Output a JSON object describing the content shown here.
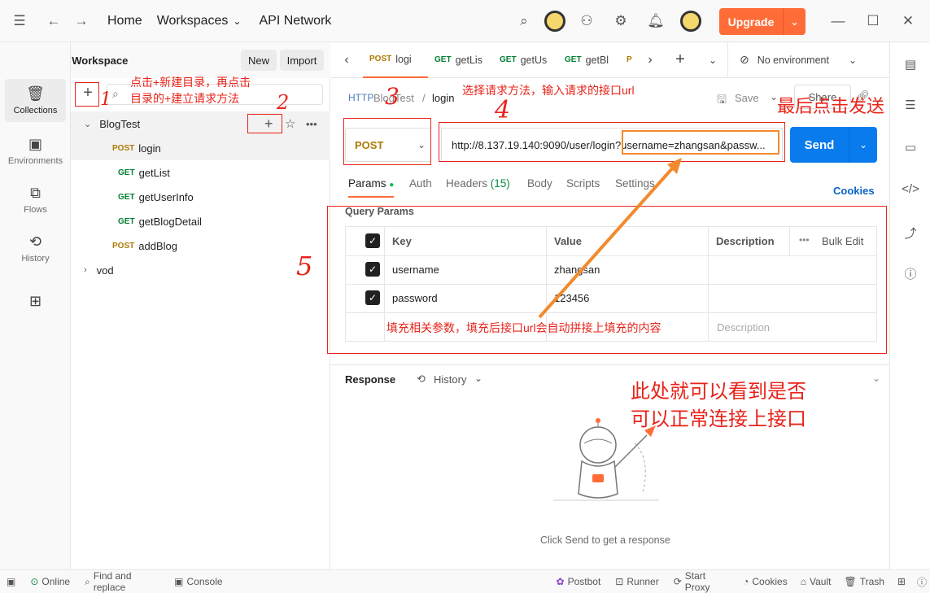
{
  "topbar": {
    "home": "Home",
    "workspaces": "Workspaces",
    "api_network": "API Network",
    "upgrade": "Upgrade"
  },
  "workspace": {
    "name": "wrrtx's Workspace",
    "new_label": "New",
    "import_label": "Import"
  },
  "rail": {
    "items": [
      {
        "label": "Collections",
        "icon": "collections-icon"
      },
      {
        "label": "Environments",
        "icon": "environments-icon"
      },
      {
        "label": "Flows",
        "icon": "flows-icon"
      },
      {
        "label": "History",
        "icon": "history-icon"
      }
    ]
  },
  "tree": {
    "collection": "BlogTest",
    "requests": [
      {
        "method": "POST",
        "name": "login"
      },
      {
        "method": "GET",
        "name": "getList"
      },
      {
        "method": "GET",
        "name": "getUserInfo"
      },
      {
        "method": "GET",
        "name": "getBlogDetail"
      },
      {
        "method": "POST",
        "name": "addBlog"
      }
    ],
    "folder2": "vod"
  },
  "tabs": [
    {
      "method": "POST",
      "name": "logi"
    },
    {
      "method": "GET",
      "name": "getLis"
    },
    {
      "method": "GET",
      "name": "getUs"
    },
    {
      "method": "GET",
      "name": "getBl"
    },
    {
      "method": "P",
      "name": ""
    }
  ],
  "environment": "No environment",
  "request": {
    "breadcrumb_collection": "BlogTest",
    "breadcrumb_sep": "/",
    "name": "login",
    "save": "Save",
    "share": "Share",
    "method": "POST",
    "url_base": "http://8.137.19.140:9090/user/login",
    "url_query": "?username=zhangsan&passw...",
    "send": "Send"
  },
  "req_tabs": {
    "params": "Params",
    "auth": "Auth",
    "headers": "Headers",
    "headers_count": "(15)",
    "body": "Body",
    "scripts": "Scripts",
    "settings": "Settings",
    "cookies": "Cookies"
  },
  "params": {
    "title": "Query Params",
    "col_key": "Key",
    "col_value": "Value",
    "col_desc": "Description",
    "bulk_edit": "Bulk Edit",
    "rows": [
      {
        "key": "username",
        "value": "zhangsan"
      },
      {
        "key": "password",
        "value": "123456"
      }
    ],
    "desc_placeholder": "Description"
  },
  "response": {
    "label": "Response",
    "history": "History",
    "hint": "Click Send to get a response"
  },
  "status_bar": {
    "online": "Online",
    "find": "Find and replace",
    "console": "Console",
    "postbot": "Postbot",
    "runner": "Runner",
    "proxy": "Start Proxy",
    "cookies": "Cookies",
    "vault": "Vault",
    "trash": "Trash"
  },
  "annotations": {
    "a1": "点击+新建目录，再点击",
    "a1b": "目录的+建立请求方法",
    "a3": "选择请求方法，输入请求的接口url",
    "a_send": "最后点击发送",
    "a5": "填充相关参数，填充后接口url会自动拼接上填充的内容",
    "a_resp1": "此处就可以看到是否",
    "a_resp2": "可以正常连接上接口",
    "n1": "1",
    "n2": "2",
    "n3": "3",
    "n4": "4",
    "n5": "5"
  },
  "colors": {
    "accent": "#ff6c37",
    "send": "#097bed",
    "annotation": "#e8231a",
    "arrow": "#f28a2e"
  }
}
